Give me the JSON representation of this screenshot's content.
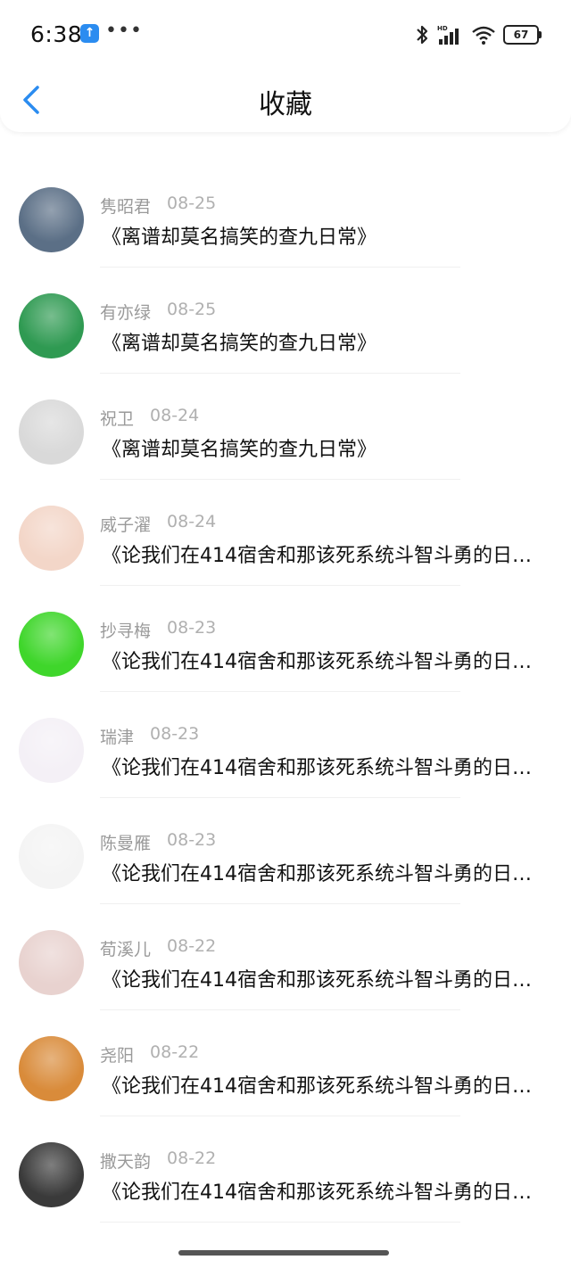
{
  "status_bar": {
    "time": "6:38",
    "battery": "67",
    "network_label": "HD"
  },
  "header": {
    "title": "收藏"
  },
  "items": [
    {
      "name": "",
      "date": "",
      "title": "《离谱却莫名搞笑的查九日常》",
      "avatar_color": "#1f3b66"
    },
    {
      "name": "隽昭君",
      "date": "08-25",
      "title": "《离谱却莫名搞笑的查九日常》",
      "avatar_color": "#5b6f86"
    },
    {
      "name": "有亦绿",
      "date": "08-25",
      "title": "《离谱却莫名搞笑的查九日常》",
      "avatar_color": "#2f9a52"
    },
    {
      "name": "祝卫",
      "date": "08-24",
      "title": "《离谱却莫名搞笑的查九日常》",
      "avatar_color": "#d9d9d9"
    },
    {
      "name": "威子濯",
      "date": "08-24",
      "title": "《论我们在414宿舍和那该死系统斗智斗勇的日常》",
      "avatar_color": "#f3d6c8"
    },
    {
      "name": "抄寻梅",
      "date": "08-23",
      "title": "《论我们在414宿舍和那该死系统斗智斗勇的日常》",
      "avatar_color": "#3fd62b"
    },
    {
      "name": "瑞津",
      "date": "08-23",
      "title": "《论我们在414宿舍和那该死系统斗智斗勇的日常》",
      "avatar_color": "#f4f0f6"
    },
    {
      "name": "陈曼雁",
      "date": "08-23",
      "title": "《论我们在414宿舍和那该死系统斗智斗勇的日常》",
      "avatar_color": "#f4f4f4"
    },
    {
      "name": "荀溪儿",
      "date": "08-22",
      "title": "《论我们在414宿舍和那该死系统斗智斗勇的日常》",
      "avatar_color": "#e8d2cf"
    },
    {
      "name": "尧阳",
      "date": "08-22",
      "title": "《论我们在414宿舍和那该死系统斗智斗勇的日常》",
      "avatar_color": "#d98b3a"
    },
    {
      "name": "撒天韵",
      "date": "08-22",
      "title": "《论我们在414宿舍和那该死系统斗智斗勇的日常》",
      "avatar_color": "#3a3a3a"
    }
  ]
}
